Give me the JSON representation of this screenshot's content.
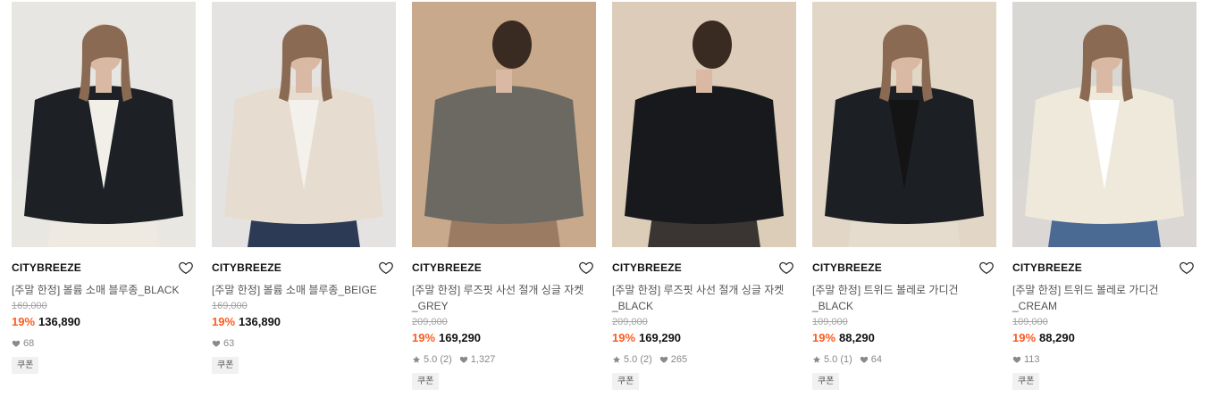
{
  "products": [
    {
      "brand": "CITYBREEZE",
      "name": "[주말 한정] 볼륨 소매 블루종_BLACK",
      "original_price": "169,000",
      "discount": "19%",
      "price": "136,890",
      "rating": null,
      "likes": "68",
      "coupon": "쿠폰",
      "image": {
        "bg": "#e8e6e2",
        "garment": "#1d2126",
        "inner": "#f2efe9",
        "pants": "#efeae1"
      }
    },
    {
      "brand": "CITYBREEZE",
      "name": "[주말 한정] 볼륨 소매 블루종_BEIGE",
      "original_price": "169,000",
      "discount": "19%",
      "price": "136,890",
      "rating": null,
      "likes": "63",
      "coupon": "쿠폰",
      "image": {
        "bg": "#e4e3e1",
        "garment": "#e6ddd0",
        "inner": "#f4f1ec",
        "pants": "#2c3a55"
      }
    },
    {
      "brand": "CITYBREEZE",
      "name": "[주말 한정] 루즈핏 사선 절개 싱글 자켓_GREY",
      "original_price": "209,000",
      "discount": "19%",
      "price": "169,290",
      "rating": "5.0 (2)",
      "likes": "1,327",
      "coupon": "쿠폰",
      "image": {
        "bg": "#c9a98c",
        "garment": "#6c6963",
        "inner": "#d2b59a",
        "pants": "#9b7b62"
      }
    },
    {
      "brand": "CITYBREEZE",
      "name": "[주말 한정] 루즈핏 사선 절개 싱글 자켓_BLACK",
      "original_price": "209,000",
      "discount": "19%",
      "price": "169,290",
      "rating": "5.0 (2)",
      "likes": "265",
      "coupon": "쿠폰",
      "image": {
        "bg": "#dcccb9",
        "garment": "#17191c",
        "inner": "#e7dac9",
        "pants": "#3a3532"
      }
    },
    {
      "brand": "CITYBREEZE",
      "name": "[주말 한정] 트위드 볼레로 가디건_BLACK",
      "original_price": "109,000",
      "discount": "19%",
      "price": "88,290",
      "rating": "5.0 (1)",
      "likes": "64",
      "coupon": "쿠폰",
      "image": {
        "bg": "#e2d6c6",
        "garment": "#1c1f24",
        "inner": "#141414",
        "pants": "#e5dccd"
      }
    },
    {
      "brand": "CITYBREEZE",
      "name": "[주말 한정] 트위드 볼레로 가디건_CREAM",
      "original_price": "109,000",
      "discount": "19%",
      "price": "88,290",
      "rating": null,
      "likes": "113",
      "coupon": "쿠폰",
      "image": {
        "bg": "#d9d7d3",
        "garment": "#efe9dc",
        "inner": "#ffffff",
        "pants": "#4a6a94"
      }
    }
  ],
  "colors": {
    "discount": "#ff5a1f",
    "muted": "#a3a3a3",
    "brand_text": "#111111"
  },
  "icons": {
    "wishlist": "heart-outline-icon",
    "like": "heart-filled-icon",
    "rating": "star-icon"
  }
}
